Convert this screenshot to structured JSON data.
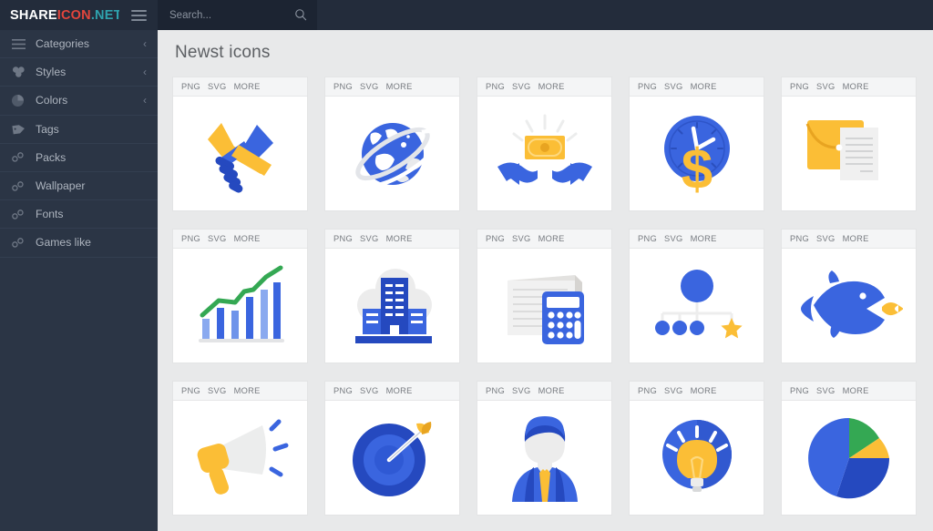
{
  "topbar": {
    "logo_part1": "SHARE",
    "logo_part2": "ICON",
    "logo_part3": ".NET",
    "menu_icon": "hamburger-icon",
    "search_placeholder": "Search...",
    "search_value": "",
    "search_icon": "search-icon"
  },
  "sidebar": {
    "items": [
      {
        "label": "Categories",
        "icon": "hamburger-icon",
        "chevron": "‹",
        "has_chevron": true
      },
      {
        "label": "Styles",
        "icon": "styles-icon",
        "chevron": "‹",
        "has_chevron": true
      },
      {
        "label": "Colors",
        "icon": "pie-icon",
        "chevron": "‹",
        "has_chevron": true
      },
      {
        "label": "Tags",
        "icon": "tag-icon",
        "chevron": "",
        "has_chevron": false
      },
      {
        "label": "Packs",
        "icon": "link-icon",
        "chevron": "",
        "has_chevron": false
      },
      {
        "label": "Wallpaper",
        "icon": "link-icon",
        "chevron": "",
        "has_chevron": false
      },
      {
        "label": "Fonts",
        "icon": "link-icon",
        "chevron": "",
        "has_chevron": false
      },
      {
        "label": "Games like",
        "icon": "link-icon",
        "chevron": "",
        "has_chevron": false
      }
    ]
  },
  "main": {
    "title": "Newst icons",
    "card_actions": {
      "png": "PNG",
      "svg": "SVG",
      "more": "MORE"
    },
    "cards": [
      {
        "icon": "handshake-icon"
      },
      {
        "icon": "globe-icon"
      },
      {
        "icon": "hands-money-icon"
      },
      {
        "icon": "clock-dollar-icon"
      },
      {
        "icon": "envelope-document-icon"
      },
      {
        "icon": "growth-bar-chart-icon"
      },
      {
        "icon": "office-building-icon"
      },
      {
        "icon": "calculator-documents-icon"
      },
      {
        "icon": "hierarchy-star-icon"
      },
      {
        "icon": "big-fish-small-fish-icon"
      },
      {
        "icon": "megaphone-icon"
      },
      {
        "icon": "target-arrow-icon"
      },
      {
        "icon": "businessman-icon"
      },
      {
        "icon": "lightbulb-idea-icon"
      },
      {
        "icon": "pie-chart-icon"
      }
    ]
  },
  "colors": {
    "topbar_bg": "#232c3b",
    "search_bg": "#1c2432",
    "sidebar_bg": "#2b3545",
    "content_bg": "#e8e9ea",
    "card_bg": "#ffffff",
    "logo_red": "#e2453c",
    "logo_teal": "#2fa3ae",
    "icon_blue": "#3a65df",
    "icon_blue_dark": "#2549bf",
    "icon_yellow": "#fbbe36",
    "icon_green": "#34a853",
    "icon_grey": "#e7e8e9"
  }
}
